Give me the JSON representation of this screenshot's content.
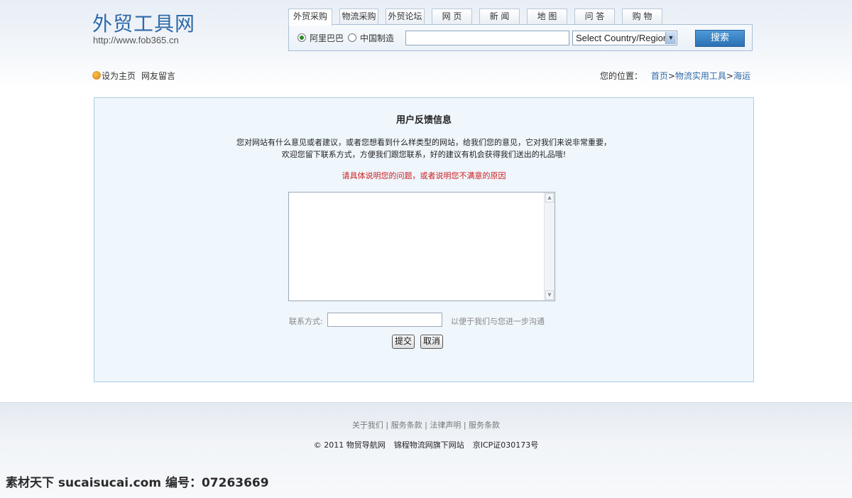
{
  "header": {
    "logo_title": "外贸工具网",
    "logo_url": "http://www.fob365.cn",
    "tabs": [
      {
        "label": "外贸采购"
      },
      {
        "label": "物流采购"
      },
      {
        "label": "外贸论坛"
      },
      {
        "label": "网 页"
      },
      {
        "label": "新 闻"
      },
      {
        "label": "地 图"
      },
      {
        "label": "问 答"
      },
      {
        "label": "购 物"
      }
    ],
    "active_tab": "外贸采购",
    "search": {
      "source_options": [
        {
          "label": "阿里巴巴",
          "selected": true
        },
        {
          "label": "中国制造",
          "selected": false
        }
      ],
      "query_value": "",
      "country_select": "Select Country/Region",
      "button_label": "搜索"
    }
  },
  "utility": {
    "set_home": "设为主页",
    "guestbook": "网友留言"
  },
  "breadcrumb": {
    "prefix": "您的位置：",
    "items": [
      "首页",
      "物流实用工具",
      "海运"
    ],
    "separator": ">"
  },
  "feedback": {
    "title": "用户反馈信息",
    "intro_line1": "您对网站有什么意见或者建议，或者您想看到什么样类型的网站，给我们您的意见，它对我们来说非常重要，",
    "intro_line2": "欢迎您留下联系方式，方便我们跟您联系，好的建议有机会获得我们送出的礼品哦!",
    "warning": "请具体说明您的问题，或者说明您不满意的原因",
    "message_value": "",
    "contact_label": "联系方式:",
    "contact_value": "",
    "contact_hint": "以便于我们与您进一步沟通",
    "submit_label": "提交",
    "cancel_label": "取消"
  },
  "footer": {
    "links": [
      "关于我们",
      "服务条款",
      "法律声明",
      "服务条款"
    ],
    "copyright": "© 2011 物贸导航网",
    "company": "锦程物流网旗下网站",
    "icp": "京ICP证030173号"
  },
  "watermark": "素材天下 sucaisucai.com  编号：07263669",
  "colors": {
    "brand_blue": "#2f6aa8",
    "panel_bg": "#eff6fc",
    "warning_red": "#cc1f1f",
    "search_button": "#2a6fb3"
  }
}
